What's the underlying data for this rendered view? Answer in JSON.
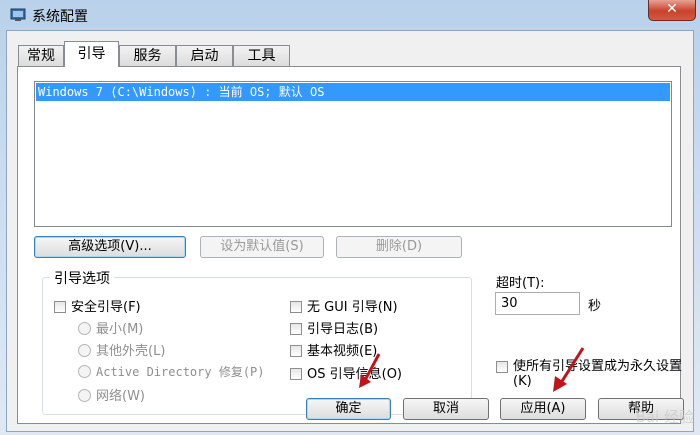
{
  "window": {
    "title": "系统配置",
    "close_symbol": "✕"
  },
  "tabs": [
    {
      "label": "常规"
    },
    {
      "label": "引导",
      "active": true
    },
    {
      "label": "服务"
    },
    {
      "label": "启动"
    },
    {
      "label": "工具"
    }
  ],
  "boot_list": {
    "items": [
      "Windows 7 (C:\\Windows) : 当前 OS; 默认 OS"
    ],
    "selected_index": 0
  },
  "buttons": {
    "advanced": "高级选项(V)...",
    "set_default": "设为默认值(S)",
    "delete": "删除(D)"
  },
  "boot_options": {
    "group_label": "引导选项",
    "safe_boot": "安全引导(F)",
    "minimal": "最小(M)",
    "alternate_shell": "其他外壳(L)",
    "ad_repair": "Active Directory 修复(P)",
    "network": "网络(W)",
    "no_gui": "无 GUI 引导(N)",
    "boot_log": "引导日志(B)",
    "base_video": "基本视频(E)",
    "os_boot_info": "OS 引导信息(O)"
  },
  "timeout": {
    "label": "超时(T):",
    "value": "30",
    "unit": "秒"
  },
  "permanent": {
    "label": "使所有引导设置成为永久设置(K)"
  },
  "footer": {
    "ok": "确定",
    "cancel": "取消",
    "apply": "应用(A)",
    "help": "帮助"
  },
  "watermark": "Bai 经验",
  "colors": {
    "selection": "#3399ff",
    "arrow": "#c0141c",
    "close": "#c7432c"
  }
}
